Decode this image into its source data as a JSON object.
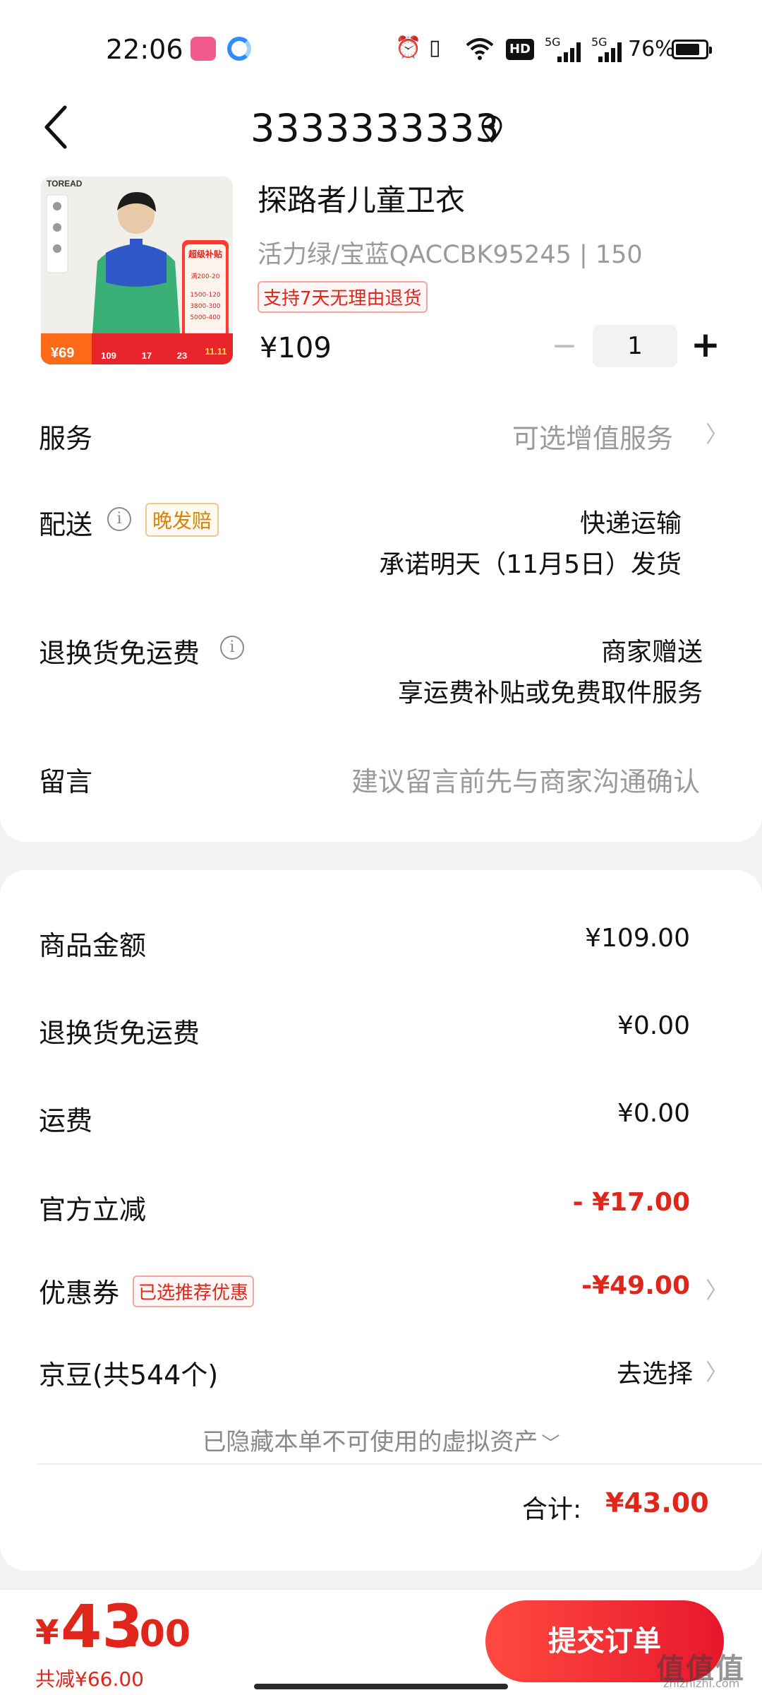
{
  "status_bar": {
    "time": "22:06",
    "network_1": "5G",
    "network_2": "5G",
    "hd": "HD",
    "battery": "76%",
    "icons": [
      "bilibili-app-icon",
      "qq-browser-app-icon",
      "alarm-icon",
      "vibrate-icon",
      "wifi-icon",
      "hd-voice-icon",
      "signal-icon",
      "signal-icon",
      "battery-icon"
    ]
  },
  "header": {
    "address": "3333333333"
  },
  "product": {
    "name": "探路者儿童卫衣",
    "spec": "活力绿/宝蓝QACCBK95245 | 150",
    "return_badge": "支持7天无理由退货",
    "price": "¥109",
    "quantity": "1",
    "image": {
      "brand": "TOREAD",
      "promo_title": "超级补贴",
      "promo_lines": [
        "满200-20",
        "1500-120",
        "3800-300",
        "5000-400"
      ],
      "coupon_price": "¥69",
      "bottom_numbers": [
        "109",
        "17",
        "23"
      ],
      "tag": "11.11"
    }
  },
  "options": {
    "service_label": "服务",
    "service_value": "可选增值服务",
    "delivery_label": "配送",
    "delivery_badge": "晚发赔",
    "delivery_method": "快递运输",
    "delivery_promise": "承诺明天（11月5日）发货",
    "return_ship_label": "退换货免运费",
    "return_ship_line1": "商家赠送",
    "return_ship_line2": "享运费补贴或免费取件服务",
    "note_label": "留言",
    "note_placeholder": "建议留言前先与商家沟通确认"
  },
  "summary": {
    "goods_label": "商品金额",
    "goods_value": "¥109.00",
    "return_ship_label": "退换货免运费",
    "return_ship_value": "¥0.00",
    "shipping_label": "运费",
    "shipping_value": "¥0.00",
    "official_label": "官方立减",
    "official_value": "- ¥17.00",
    "coupon_label": "优惠券",
    "coupon_badge": "已选推荐优惠",
    "coupon_value": "-¥49.00",
    "beans_label": "京豆(共544个)",
    "beans_value": "去选择",
    "hidden_assets": "已隐藏本单不可使用的虚拟资产",
    "total_label": "合计:",
    "total_value": "¥43.00"
  },
  "footer": {
    "currency": "¥",
    "pay_int": "43",
    "pay_dec": ".00",
    "saved": "共减¥66.00",
    "submit": "提交订单",
    "watermark": "值值值",
    "watermark_sub": "zhizhizhi.com"
  },
  "colors": {
    "accent_red": "#e0261b",
    "late_badge_orange": "#d98400",
    "page_bg": "#f2f2f2"
  }
}
